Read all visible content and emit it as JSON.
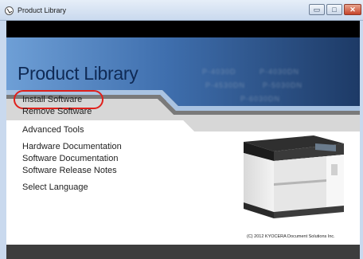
{
  "window": {
    "title": "Product Library",
    "buttons": {
      "minimize": "▭",
      "maximize": "□",
      "close": "✕"
    }
  },
  "banner": {
    "title": "Product Library",
    "models": [
      "P-4030D",
      "P-4030DN",
      "P-4530DN",
      "P-5030DN",
      "P-6030DN"
    ]
  },
  "menu": {
    "install_software": "Install Software",
    "remove_software": "Remove Software",
    "advanced_tools": "Advanced Tools",
    "hardware_documentation": "Hardware Documentation",
    "software_documentation": "Software Documentation",
    "software_release_notes": "Software Release Notes",
    "select_language": "Select Language"
  },
  "footer": {
    "copyright": "(C) 2012 KYOCERA Document Solutions Inc."
  },
  "colors": {
    "banner_blue": "#4f86c6",
    "title_navy": "#0f2a55",
    "highlight_red": "#e0201b"
  },
  "icons": {
    "app": "app-icon",
    "printer": "printer-image"
  }
}
